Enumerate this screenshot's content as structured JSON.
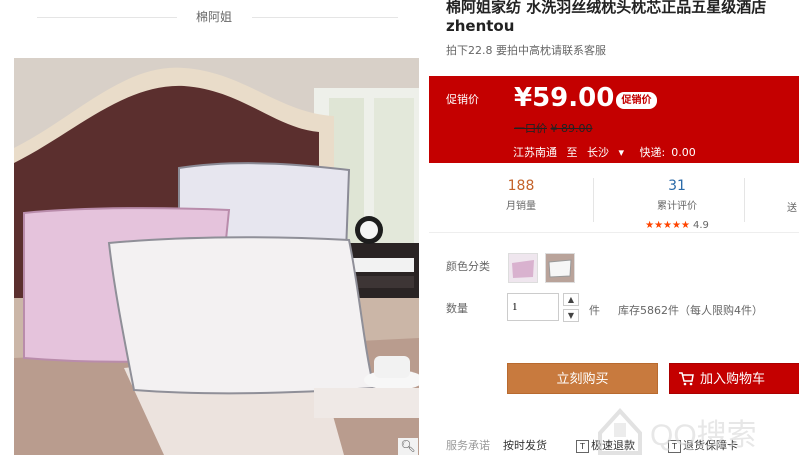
{
  "shop": {
    "name": "棉阿姐"
  },
  "product": {
    "title_line1": "棉阿姐家纺 水洗羽丝绒枕头枕芯正品五星级酒店",
    "title_line2": "zhentou",
    "subtitle": "拍下22.8 要拍中高枕请联系客服"
  },
  "price": {
    "promo_label": "促销价",
    "value": "¥59.00",
    "badge": "促销价",
    "orig_label": "一口价",
    "orig_value": "¥ 89.00",
    "ship_from": "江苏南通",
    "ship_to_word": "至",
    "ship_to": "长沙",
    "express_label": "快递:",
    "express_value": "0.00"
  },
  "stats": {
    "sales_count": "188",
    "sales_label": "月销量",
    "reviews_count": "31",
    "reviews_label": "累计评价",
    "stars": "★★★★★",
    "rating": "4.9",
    "third_partial": "送"
  },
  "options": {
    "color_label": "颜色分类",
    "qty_label": "数量",
    "qty_value": "1",
    "qty_unit": "件",
    "stock": "库存5862件（每人限购4件）"
  },
  "buttons": {
    "buy": "立刻购买",
    "cart": "加入购物车"
  },
  "promise": {
    "label": "服务承诺",
    "items": [
      "按时发货",
      "极速退款",
      "退货保障卡"
    ],
    "tags": [
      "T",
      "T"
    ]
  },
  "watermark": {
    "text": "QQ搜索"
  },
  "colors": {
    "accent_red": "#c40000",
    "buy_orange": "#c87a3e",
    "orange_text": "#f40"
  }
}
